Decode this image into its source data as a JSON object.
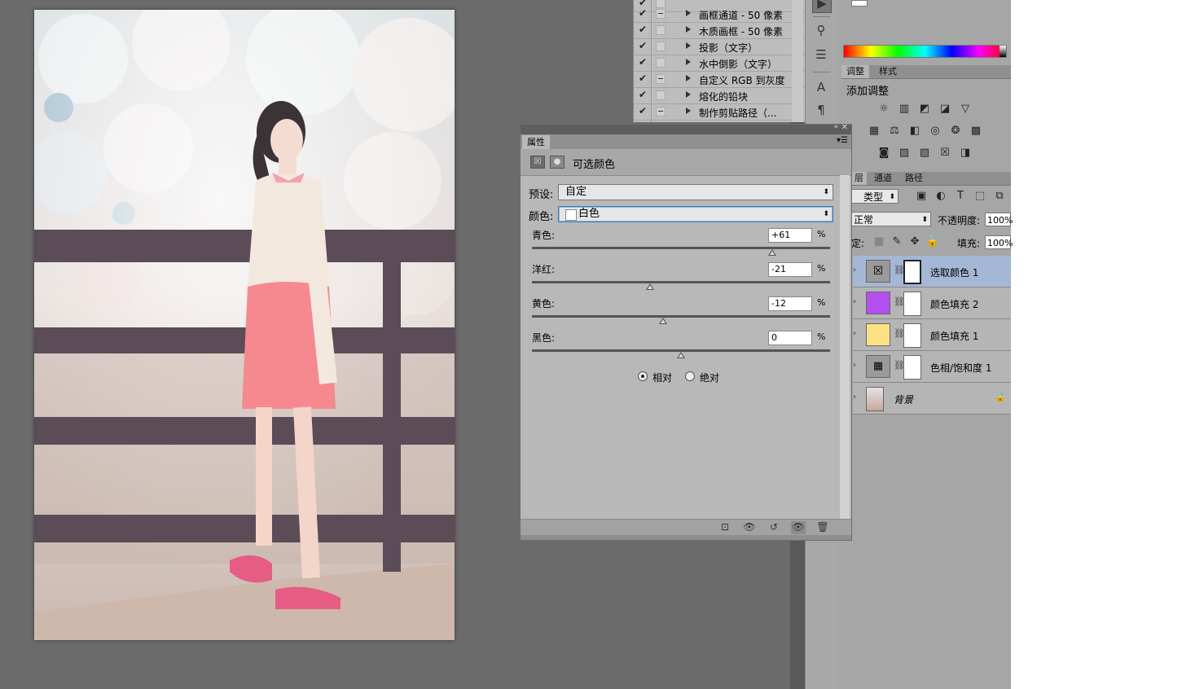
{
  "actions": {
    "items": [
      {
        "label": "画框通道 - 50 像素",
        "expanded": false
      },
      {
        "label": "木质画框 - 50 像素",
        "expanded": false
      },
      {
        "label": "投影（文字）",
        "expanded": false
      },
      {
        "label": "水中倒影（文字）",
        "expanded": false
      },
      {
        "label": "自定义 RGB 到灰度",
        "expanded": false
      },
      {
        "label": "熔化的铅块",
        "expanded": false
      },
      {
        "label": "制作剪贴路径（...",
        "expanded": false
      }
    ]
  },
  "adjustments_panel": {
    "tabs": [
      "调整",
      "样式"
    ],
    "title": "添加调整"
  },
  "layers_panel": {
    "tabs": [
      "层",
      "通道",
      "路径"
    ],
    "filter_kind": "类型",
    "blend_mode": "正常",
    "opacity_label": "不透明度:",
    "opacity_value": "100%",
    "lock_label": "定:",
    "fill_label": "填充:",
    "fill_value": "100%",
    "layers": [
      {
        "name": "选取颜色 1",
        "thumb_color": "#9a9a9a",
        "selected": true
      },
      {
        "name": "颜色填充 2",
        "thumb_color": "#b44ff0",
        "selected": false
      },
      {
        "name": "颜色填充 1",
        "thumb_color": "#fbe184",
        "selected": false
      },
      {
        "name": "色相/饱和度 1",
        "thumb_color": "#9a9a9a",
        "selected": false
      },
      {
        "name": "背景",
        "thumb_color": "#d4b8a8",
        "selected": false
      }
    ]
  },
  "properties": {
    "tab": "属性",
    "title": "可选颜色",
    "preset_label": "预设:",
    "preset_value": "自定",
    "colors_label": "颜色:",
    "colors_value": "白色",
    "sliders": [
      {
        "label": "青色:",
        "value": "+61",
        "fraction": 0.805
      },
      {
        "label": "洋红:",
        "value": "-21",
        "fraction": 0.395
      },
      {
        "label": "黄色:",
        "value": "-12",
        "fraction": 0.44
      },
      {
        "label": "黑色:",
        "value": "0",
        "fraction": 0.5
      }
    ],
    "percent": "%",
    "method": {
      "relative": "相对",
      "absolute": "绝对",
      "selected": "relative"
    }
  }
}
